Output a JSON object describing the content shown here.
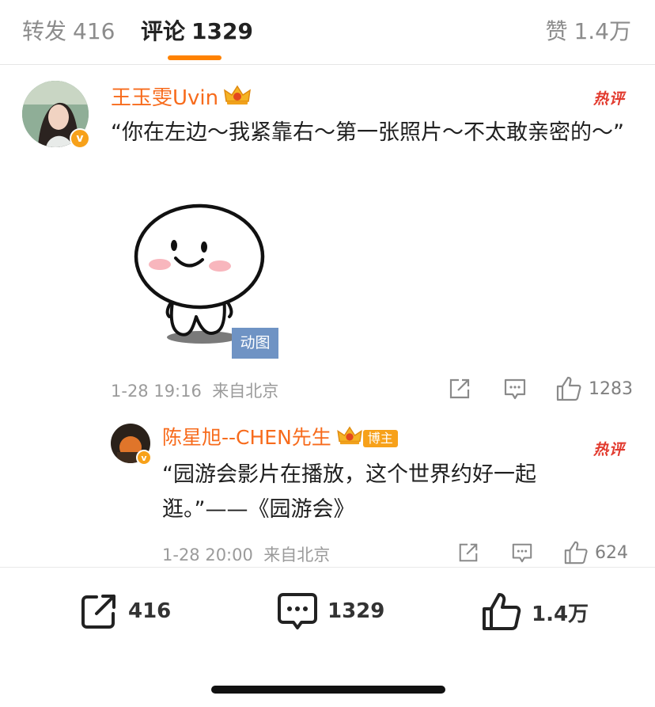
{
  "tabs": {
    "repost": {
      "label": "转发",
      "count": "416"
    },
    "comment": {
      "label": "评论",
      "count": "1329"
    },
    "like": {
      "label": "赞",
      "count": "1.4万"
    }
  },
  "comments": [
    {
      "user": "王玉雯Uvin",
      "hot_label": "热评",
      "text": "“你在左边～我紧靠右～第一张照片～不太敢亲密的～”",
      "sticker_tag": "动图",
      "time": "1-28 19:16",
      "location": "来自北京",
      "likes": "1283"
    },
    {
      "user": "陈星旭--CHEN先生",
      "author_badge": "博主",
      "hot_label": "热评",
      "text": "“园游会影片在播放，这个世界约好一起逛。”——《园游会》",
      "time": "1-28 20:00",
      "location": "来自北京",
      "likes": "624"
    }
  ],
  "bottom_bar": {
    "repost_count": "416",
    "comment_count": "1329",
    "like_count": "1.4万"
  },
  "colors": {
    "accent": "#ff8200",
    "username": "#f76b1c",
    "hot": "#e23a2e",
    "gif_tag": "#6f93c4"
  }
}
